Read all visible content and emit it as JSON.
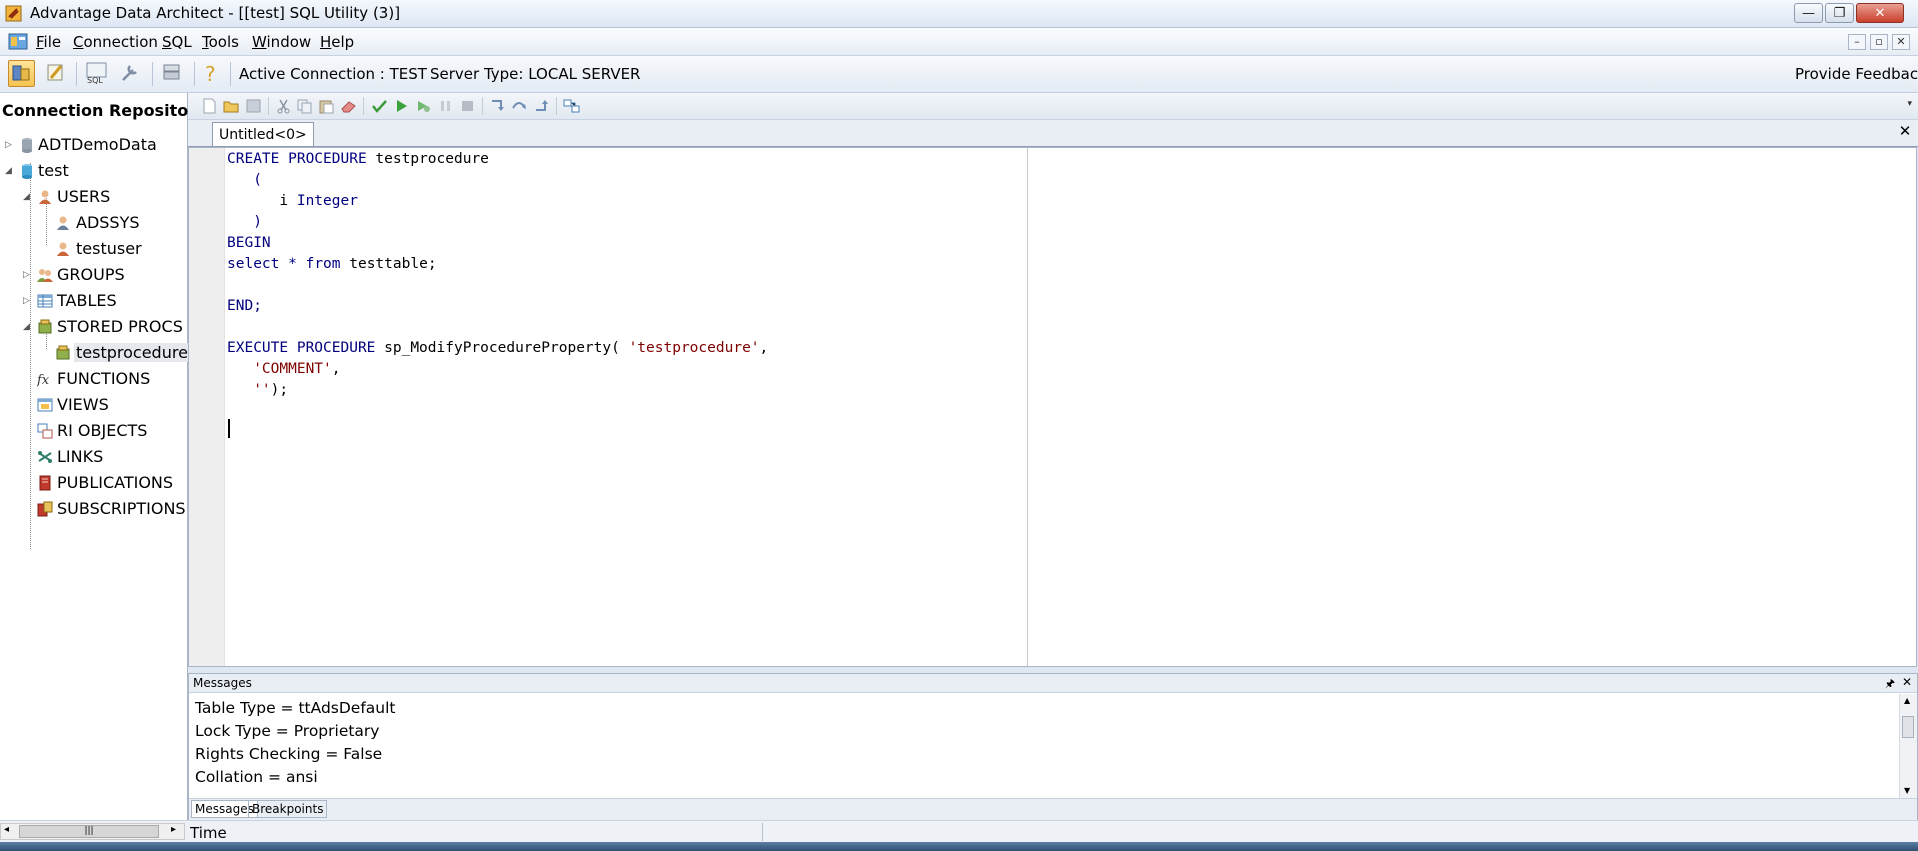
{
  "window": {
    "title": "Advantage Data Architect - [[test] SQL Utility (3)]",
    "minimize": "—",
    "restore": "❐",
    "close": "✕"
  },
  "menu": {
    "items": [
      {
        "u": "F",
        "rest": "ile"
      },
      {
        "u": "C",
        "rest": "onnection"
      },
      {
        "u": "S",
        "rest": "QL"
      },
      {
        "u": "T",
        "rest": "ools"
      },
      {
        "u": "W",
        "rest": "indow"
      },
      {
        "u": "H",
        "rest": "elp"
      }
    ],
    "mdi_minimize": "–",
    "mdi_restore": "▫",
    "mdi_close": "✕"
  },
  "toolbar": {
    "active_connection": "Active Connection : TEST",
    "server_type": "Server Type: LOCAL SERVER",
    "provide_feedback": "Provide Feedback",
    "sql_label": "SQL"
  },
  "repository": {
    "header": "Connection Repository",
    "nodes": [
      {
        "label": "ADTDemoData"
      },
      {
        "label": "test"
      },
      {
        "label": "USERS"
      },
      {
        "label": "ADSSYS"
      },
      {
        "label": "testuser"
      },
      {
        "label": "GROUPS"
      },
      {
        "label": "TABLES"
      },
      {
        "label": "STORED PROCS"
      },
      {
        "label": "testprocedure"
      },
      {
        "label": "FUNCTIONS"
      },
      {
        "label": "VIEWS"
      },
      {
        "label": "RI OBJECTS"
      },
      {
        "label": "LINKS"
      },
      {
        "label": "PUBLICATIONS"
      },
      {
        "label": "SUBSCRIPTIONS"
      }
    ]
  },
  "editor": {
    "tab_label": "Untitled<0>",
    "tab_close": "✕",
    "code": {
      "l1_kw": "CREATE PROCEDURE",
      "l1_name": " testprocedure",
      "l2": "   (",
      "l3_a": "      i ",
      "l3_kw": "Integer",
      "l4": "   )",
      "l5": "BEGIN",
      "l6_kw1": "select",
      "l6_mid": " * ",
      "l6_kw2": "from",
      "l6_end": " testtable;",
      "l7": "END;",
      "l8_kw": "EXECUTE PROCEDURE",
      "l8_name": " sp_ModifyProcedureProperty( ",
      "l8_str": "'testprocedure'",
      "l8_end": ",",
      "l9_pre": "   ",
      "l9_str": "'COMMENT'",
      "l9_end": ",",
      "l10_pre": "   ",
      "l10_str": "''",
      "l10_end": ");"
    }
  },
  "messages": {
    "caption": "Messages",
    "pin": "🖈",
    "close": "✕",
    "lines": [
      "Table Type = ttAdsDefault",
      "Lock Type = Proprietary",
      "Rights Checking = False",
      "Collation = ansi"
    ],
    "tabs": [
      "Messages",
      "Breakpoints"
    ]
  },
  "status": {
    "time_label": "Time",
    "scroll_grip": "|||"
  }
}
